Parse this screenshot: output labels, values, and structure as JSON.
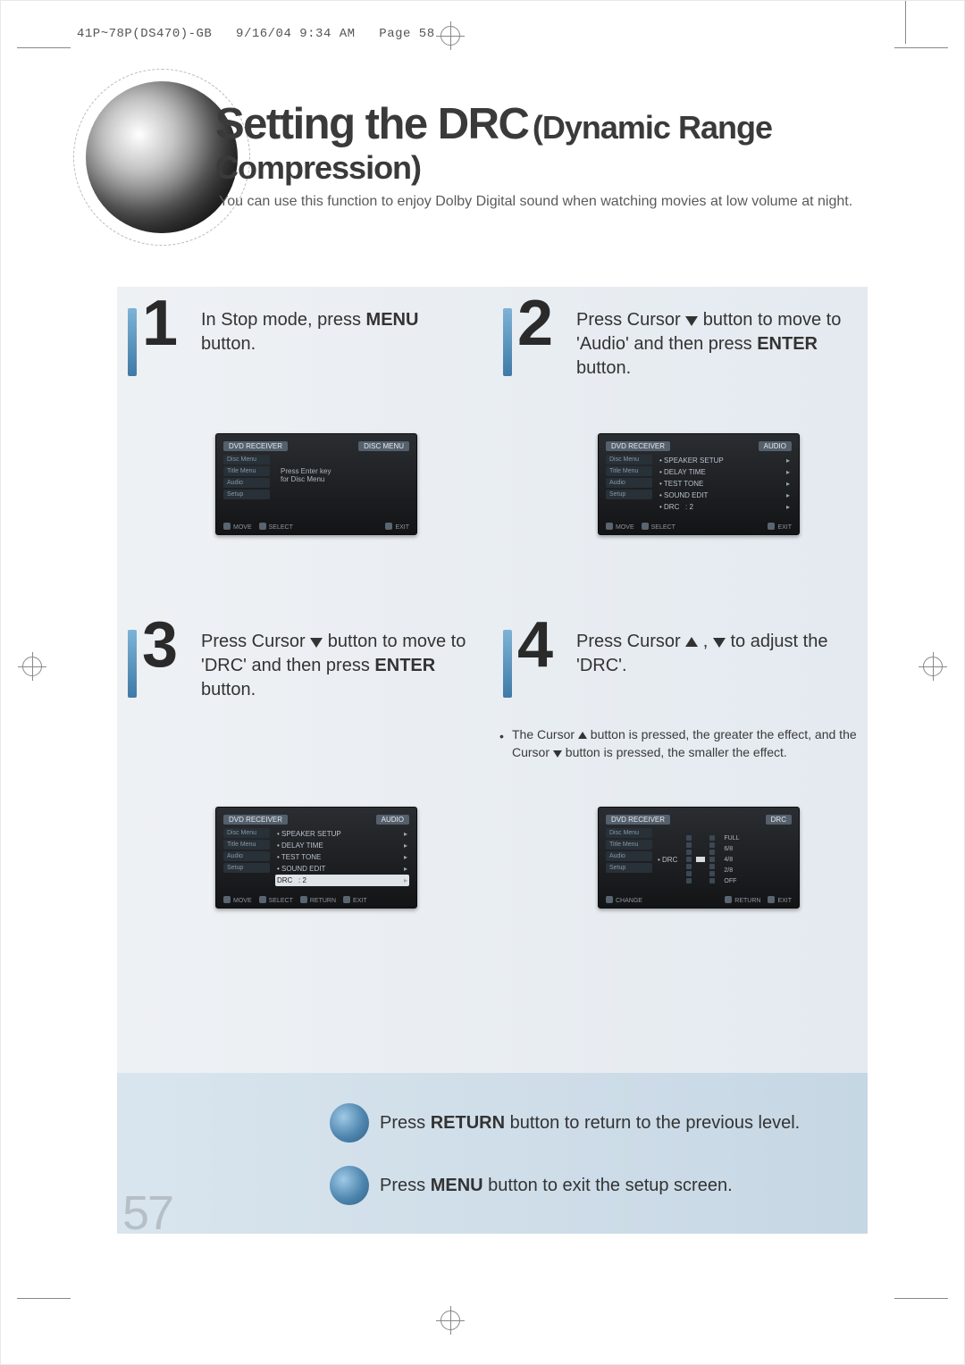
{
  "header": {
    "file": "41P~78P(DS470)-GB",
    "date": "9/16/04 9:34 AM",
    "page_label": "Page 58"
  },
  "title": {
    "main": "Setting the DRC",
    "sub": "(Dynamic Range Compression)"
  },
  "intro": "You can use this function to enjoy Dolby Digital sound when watching movies at low volume at night.",
  "steps": {
    "s1": {
      "num": "1",
      "pre": "In Stop mode, press ",
      "bold": "MENU",
      "post": " button."
    },
    "s2": {
      "num": "2",
      "a": "Press Cursor ",
      "b": " button to move to 'Audio' and then press ",
      "bold": "ENTER",
      "c": " button."
    },
    "s3": {
      "num": "3",
      "a": "Press Cursor ",
      "b": " button to move to 'DRC' and then press ",
      "bold": "ENTER",
      "c": " button."
    },
    "s4": {
      "num": "4",
      "a": "Press Cursor ",
      "b": " to adjust the 'DRC'."
    },
    "note4": {
      "a": "The Cursor ",
      "b": " button is pressed, the greater the effect, and the Cursor ",
      "c": " button is pressed, the smaller the effect."
    }
  },
  "osd_common": {
    "brand": "DVD RECEIVER",
    "side": [
      "Disc Menu",
      "Title Menu",
      "Audio",
      "Setup"
    ],
    "foot_move": "MOVE",
    "foot_select": "SELECT",
    "foot_return": "RETURN",
    "foot_exit": "EXIT",
    "foot_change": "CHANGE"
  },
  "osd1": {
    "title": "DISC MENU",
    "line1": "Press Enter key",
    "line2": "for Disc Menu"
  },
  "osd2": {
    "title": "AUDIO",
    "items": [
      "SPEAKER SETUP",
      "DELAY TIME",
      "TEST TONE",
      "SOUND EDIT"
    ],
    "drc_label": "DRC",
    "drc_val": ": 2"
  },
  "osd3": {
    "title": "AUDIO",
    "items": [
      "SPEAKER SETUP",
      "DELAY TIME",
      "TEST TONE",
      "SOUND EDIT"
    ],
    "drc_label": "DRC",
    "drc_val": ": 2"
  },
  "osd4": {
    "title": "DRC",
    "label": "DRC",
    "levels": [
      "FULL",
      "6/8",
      "4/8",
      "2/8",
      "OFF"
    ]
  },
  "footer": {
    "line1a": "Press ",
    "line1b": "RETURN",
    "line1c": " button to return to the previous level.",
    "line2a": "Press ",
    "line2b": "MENU",
    "line2c": " button to exit the setup screen."
  },
  "page_number": "57"
}
